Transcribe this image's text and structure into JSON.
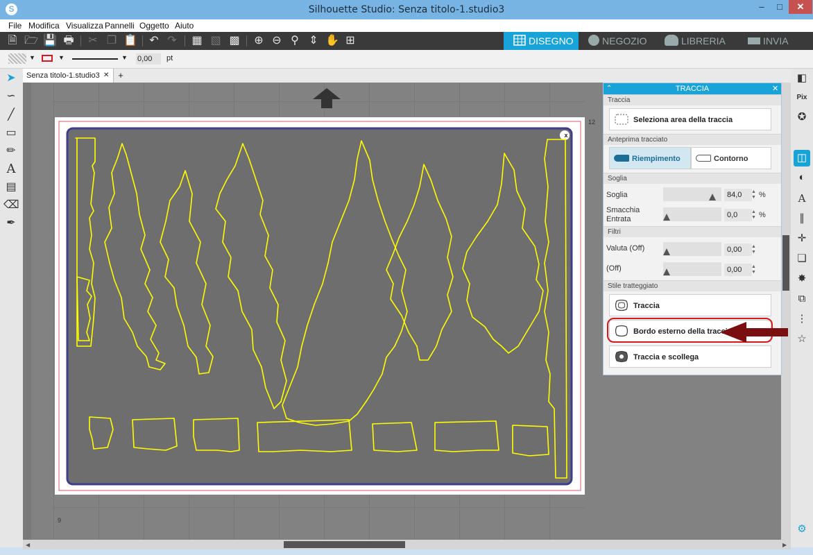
{
  "window": {
    "title": "Silhouette Studio: Senza titolo-1.studio3"
  },
  "menu": [
    "File",
    "Modifica",
    "Visualizza",
    "Pannelli",
    "Oggetto",
    "Aiuto"
  ],
  "modes": [
    {
      "label": "DISEGNO",
      "active": true
    },
    {
      "label": "NEGOZIO",
      "active": false
    },
    {
      "label": "LIBRERIA",
      "active": false
    },
    {
      "label": "INVIA",
      "active": false
    }
  ],
  "propbar": {
    "line_width": "0,00",
    "unit": "pt"
  },
  "document": {
    "tab_label": "Senza titolo-1.studio3",
    "add_tab": "+",
    "ruler_top": "12",
    "ruler_left": "9",
    "mat_close": "x"
  },
  "trace_panel": {
    "title": "TRACCIA",
    "sections": {
      "traccia": "Traccia",
      "anteprima": "Anteprima tracciato",
      "soglia": "Soglia",
      "filtri": "Filtri",
      "stile": "Stile tratteggiato"
    },
    "select_area": "Seleziona area della traccia",
    "fill_label": "Riempimento",
    "outline_label": "Contorno",
    "threshold": {
      "label": "Soglia",
      "value": "84,0",
      "unit": "%",
      "level": 0.84
    },
    "scale": {
      "label1": "Smacchia",
      "label2": "Entrata",
      "value": "0,0",
      "unit": "%",
      "level": 0
    },
    "highpass": {
      "label": "Valuta (Off)",
      "value": "0,00",
      "level": 0
    },
    "lowpass": {
      "label": "(Off)",
      "value": "0,00",
      "level": 0
    },
    "styles": [
      "Traccia",
      "Bordo esterno della traccia",
      "Traccia e scollega"
    ]
  },
  "colors": {
    "accent": "#1aa3d6",
    "trace": "#ffff00",
    "annotation": "#d8161d",
    "arrow": "#7a0f12"
  }
}
